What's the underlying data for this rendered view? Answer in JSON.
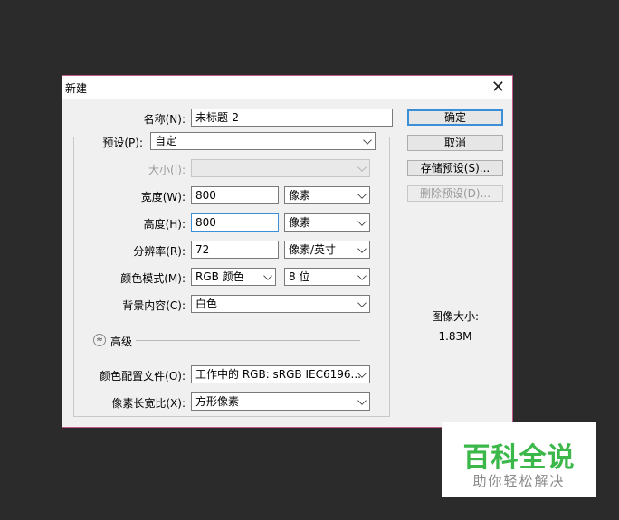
{
  "dialog": {
    "title": "新建",
    "close_glyph": "✕",
    "name": {
      "label": "名称(N):",
      "value": "未标题-2"
    },
    "preset": {
      "label": "预设(P):",
      "value": "自定"
    },
    "size": {
      "label": "大小(I):",
      "value": ""
    },
    "width": {
      "label": "宽度(W):",
      "value": "800",
      "unit": "像素"
    },
    "height": {
      "label": "高度(H):",
      "value": "800",
      "unit": "像素"
    },
    "resolution": {
      "label": "分辨率(R):",
      "value": "72",
      "unit": "像素/英寸"
    },
    "color_mode": {
      "label": "颜色模式(M):",
      "mode": "RGB 颜色",
      "depth": "8 位"
    },
    "background": {
      "label": "背景内容(C):",
      "value": "白色"
    },
    "advanced": {
      "label": "高级",
      "icon": "chevron-up-double-icon",
      "glyph": "≈"
    },
    "color_profile": {
      "label": "颜色配置文件(O):",
      "value": "工作中的 RGB: sRGB IEC6196..."
    },
    "pixel_aspect": {
      "label": "像素长宽比(X):",
      "value": "方形像素"
    },
    "buttons": {
      "ok": "确定",
      "cancel": "取消",
      "save_preset": "存储预设(S)...",
      "delete_preset": "删除预设(D)..."
    },
    "image_size": {
      "label": "图像大小:",
      "value": "1.83M"
    }
  },
  "watermark": {
    "main": "百科全说",
    "sub": "助你轻松解决"
  },
  "colors": {
    "accent": "#3c8fd6",
    "dialog_border": "#c0588a",
    "background": "#2b2b2b",
    "watermark_green": "#3cb84a"
  }
}
